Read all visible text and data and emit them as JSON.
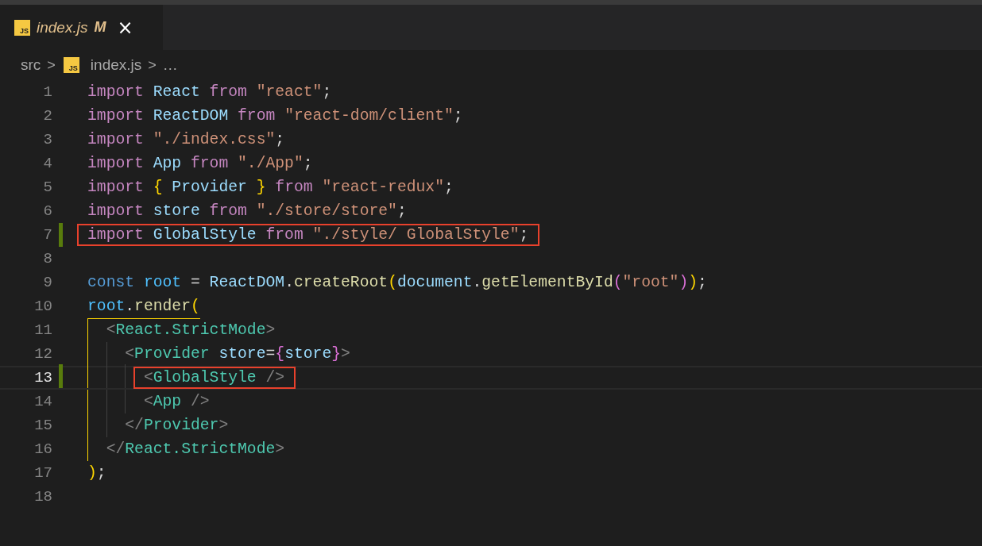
{
  "tab": {
    "icon_label": "JS",
    "label": "index.js",
    "status": "M",
    "close": "×",
    "modified": true,
    "selected": true
  },
  "breadcrumbs": [
    {
      "kind": "text",
      "text": "src"
    },
    {
      "kind": "sep",
      "text": ">"
    },
    {
      "kind": "file",
      "icon_label": "JS",
      "text": "index.js"
    },
    {
      "kind": "sep",
      "text": ">"
    },
    {
      "kind": "text",
      "text": "…"
    }
  ],
  "lines": [
    {
      "number": "1",
      "modified": false,
      "current": false,
      "boxed": false,
      "tokens": [
        {
          "kind": "kw",
          "text": "import"
        },
        {
          "kind": "var",
          "text": " React"
        },
        {
          "kind": "kw",
          "text": " from"
        },
        {
          "kind": "str",
          "text": " \"react\""
        },
        {
          "kind": "p",
          "text": ";"
        }
      ]
    },
    {
      "number": "2",
      "modified": false,
      "current": false,
      "boxed": false,
      "tokens": [
        {
          "kind": "kw",
          "text": "import"
        },
        {
          "kind": "var",
          "text": " ReactDOM"
        },
        {
          "kind": "kw",
          "text": " from"
        },
        {
          "kind": "str",
          "text": " \"react-dom/client\""
        },
        {
          "kind": "p",
          "text": ";"
        }
      ]
    },
    {
      "number": "3",
      "modified": false,
      "current": false,
      "boxed": false,
      "tokens": [
        {
          "kind": "kw",
          "text": "import"
        },
        {
          "kind": "str",
          "text": " \"./index.css\""
        },
        {
          "kind": "p",
          "text": ";"
        }
      ]
    },
    {
      "number": "4",
      "modified": false,
      "current": false,
      "boxed": false,
      "tokens": [
        {
          "kind": "kw",
          "text": "import"
        },
        {
          "kind": "var",
          "text": " App"
        },
        {
          "kind": "kw",
          "text": " from"
        },
        {
          "kind": "str",
          "text": " \"./App\""
        },
        {
          "kind": "p",
          "text": ";"
        }
      ]
    },
    {
      "number": "5",
      "modified": false,
      "current": false,
      "boxed": false,
      "tokens": [
        {
          "kind": "kw",
          "text": "import"
        },
        {
          "kind": "br1",
          "text": " {"
        },
        {
          "kind": "var",
          "text": " Provider"
        },
        {
          "kind": "br1",
          "text": " }"
        },
        {
          "kind": "kw",
          "text": " from"
        },
        {
          "kind": "str",
          "text": " \"react-redux\""
        },
        {
          "kind": "p",
          "text": ";"
        }
      ]
    },
    {
      "number": "6",
      "modified": false,
      "current": false,
      "boxed": false,
      "tokens": [
        {
          "kind": "kw",
          "text": "import"
        },
        {
          "kind": "var",
          "text": " store"
        },
        {
          "kind": "kw",
          "text": " from"
        },
        {
          "kind": "str",
          "text": " \"./store/store\""
        },
        {
          "kind": "p",
          "text": ";"
        }
      ]
    },
    {
      "number": "7",
      "modified": true,
      "current": false,
      "boxed": true,
      "tokens": [
        {
          "kind": "kw",
          "text": "import"
        },
        {
          "kind": "var",
          "text": " GlobalStyle"
        },
        {
          "kind": "kw",
          "text": " from"
        },
        {
          "kind": "str",
          "text": " \"./style/ GlobalStyle\""
        },
        {
          "kind": "p",
          "text": ";"
        }
      ]
    },
    {
      "number": "8",
      "modified": false,
      "current": false,
      "boxed": false
    },
    {
      "number": "9",
      "modified": false,
      "current": false,
      "boxed": false,
      "tokens": [
        {
          "kind": "decl",
          "text": "const"
        },
        {
          "kind": "const",
          "text": " root"
        },
        {
          "kind": "p",
          "text": " ="
        },
        {
          "kind": "var",
          "text": " ReactDOM"
        },
        {
          "kind": "p",
          "text": "."
        },
        {
          "kind": "fn",
          "text": "createRoot"
        },
        {
          "kind": "br1",
          "text": "("
        },
        {
          "kind": "var",
          "text": "document"
        },
        {
          "kind": "p",
          "text": "."
        },
        {
          "kind": "fn",
          "text": "getElementById"
        },
        {
          "kind": "br2",
          "text": "("
        },
        {
          "kind": "str",
          "text": "\"root\""
        },
        {
          "kind": "br2",
          "text": ")"
        },
        {
          "kind": "br1",
          "text": ")"
        },
        {
          "kind": "p",
          "text": ";"
        }
      ]
    },
    {
      "number": "10",
      "modified": false,
      "current": false,
      "boxed": false,
      "tokens": [
        {
          "kind": "const",
          "text": "root"
        },
        {
          "kind": "p",
          "text": "."
        },
        {
          "kind": "fn",
          "text": "render"
        },
        {
          "kind": "br1",
          "text": "("
        }
      ]
    },
    {
      "number": "11",
      "modified": false,
      "current": false,
      "boxed": false,
      "tokens": [
        {
          "kind": "tagp",
          "text": "  <"
        },
        {
          "kind": "tag",
          "text": "React.StrictMode"
        },
        {
          "kind": "tagp",
          "text": ">"
        }
      ]
    },
    {
      "number": "12",
      "modified": false,
      "current": false,
      "boxed": false,
      "tokens": [
        {
          "kind": "tagp",
          "text": "    <"
        },
        {
          "kind": "tag",
          "text": "Provider"
        },
        {
          "kind": "var",
          "text": " store"
        },
        {
          "kind": "p",
          "text": "="
        },
        {
          "kind": "br2",
          "text": "{"
        },
        {
          "kind": "var",
          "text": "store"
        },
        {
          "kind": "br2",
          "text": "}"
        },
        {
          "kind": "tagp",
          "text": ">"
        }
      ]
    },
    {
      "number": "13",
      "modified": true,
      "current": true,
      "boxed": true,
      "tokens": [
        {
          "kind": "tagp",
          "text": "      <"
        },
        {
          "kind": "tag",
          "text": "GlobalStyle"
        },
        {
          "kind": "tagp",
          "text": " />"
        }
      ]
    },
    {
      "number": "14",
      "modified": false,
      "current": false,
      "boxed": false,
      "tokens": [
        {
          "kind": "tagp",
          "text": "      <"
        },
        {
          "kind": "tag",
          "text": "App"
        },
        {
          "kind": "tagp",
          "text": " />"
        }
      ]
    },
    {
      "number": "15",
      "modified": false,
      "current": false,
      "boxed": false,
      "tokens": [
        {
          "kind": "tagp",
          "text": "    </"
        },
        {
          "kind": "tag",
          "text": "Provider"
        },
        {
          "kind": "tagp",
          "text": ">"
        }
      ]
    },
    {
      "number": "16",
      "modified": false,
      "current": false,
      "boxed": false,
      "tokens": [
        {
          "kind": "tagp",
          "text": "  </"
        },
        {
          "kind": "tag",
          "text": "React.StrictMode"
        },
        {
          "kind": "tagp",
          "text": ">"
        }
      ]
    },
    {
      "number": "17",
      "modified": false,
      "current": false,
      "boxed": false,
      "tokens": [
        {
          "kind": "br1",
          "text": ")"
        },
        {
          "kind": "p",
          "text": ";"
        }
      ]
    },
    {
      "number": "18",
      "modified": false,
      "current": false,
      "boxed": false
    }
  ]
}
